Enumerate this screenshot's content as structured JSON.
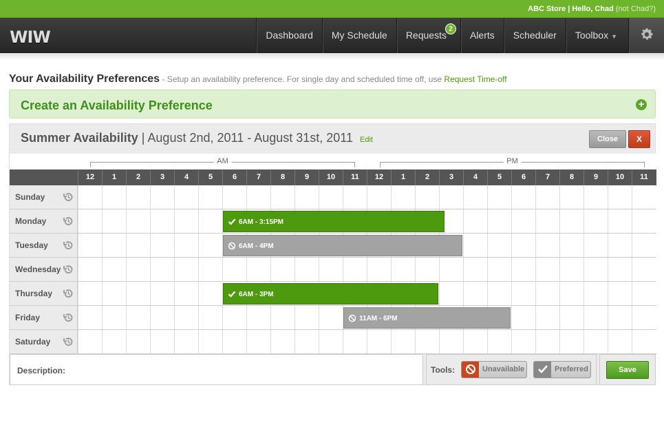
{
  "topbar": {
    "user_text": "ABC Store | Hello, Chad",
    "not_user": "(not Chad?)"
  },
  "logo": "WIW",
  "nav": {
    "items": [
      "Dashboard",
      "My Schedule",
      "Requests",
      "Alerts",
      "Scheduler",
      "Toolbox"
    ],
    "requests_badge": "2"
  },
  "page": {
    "title": "Your Availability Preferences",
    "subtitle": " - Setup an availability preference. For single day and scheduled time off, use ",
    "link": "Request Time-off"
  },
  "create": {
    "label": "Create an Availability Preference"
  },
  "panel": {
    "name": "Summer Availability",
    "range": " | August 2nd, 2011 - August 31st, 2011",
    "edit": "Edit",
    "close": "Close",
    "x": "X"
  },
  "grid": {
    "am_label": "AM",
    "pm_label": "PM",
    "hours": [
      "12",
      "1",
      "2",
      "3",
      "4",
      "5",
      "6",
      "7",
      "8",
      "9",
      "10",
      "11",
      "12",
      "1",
      "2",
      "3",
      "4",
      "5",
      "6",
      "7",
      "8",
      "9",
      "10",
      "11"
    ],
    "days": [
      "Sunday",
      "Monday",
      "Tuesday",
      "Wednesday",
      "Thursday",
      "Friday",
      "Saturday"
    ],
    "blocks": [
      {
        "day": 1,
        "start": 6,
        "end": 15.25,
        "type": "preferred",
        "label": "6AM - 3:15PM"
      },
      {
        "day": 2,
        "start": 6,
        "end": 16,
        "type": "unavailable",
        "label": "6AM - 4PM"
      },
      {
        "day": 4,
        "start": 6,
        "end": 15,
        "type": "preferred",
        "label": "6AM - 3PM"
      },
      {
        "day": 5,
        "start": 11,
        "end": 18,
        "type": "unavailable",
        "label": "11AM - 6PM"
      }
    ]
  },
  "footer": {
    "description_label": "Description:",
    "tools_label": "Tools:",
    "unavailable": "Unavailable",
    "preferred": "Preferred",
    "save": "Save"
  },
  "colors": {
    "brand_green": "#6fb52c",
    "preferred": "#4d9a0e",
    "unavailable": "#a3a3a3",
    "danger": "#c03d1a"
  }
}
